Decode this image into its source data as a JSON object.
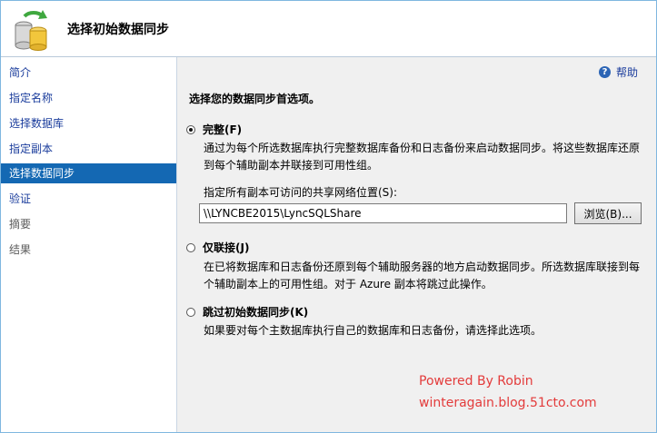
{
  "header": {
    "title": "选择初始数据同步",
    "icon": "database-sync-icon"
  },
  "sidebar": {
    "items": [
      {
        "label": "简介",
        "state": "link"
      },
      {
        "label": "指定名称",
        "state": "link"
      },
      {
        "label": "选择数据库",
        "state": "link"
      },
      {
        "label": "指定副本",
        "state": "link"
      },
      {
        "label": "选择数据同步",
        "state": "active"
      },
      {
        "label": "验证",
        "state": "link"
      },
      {
        "label": "摘要",
        "state": "disabled"
      },
      {
        "label": "结果",
        "state": "disabled"
      }
    ]
  },
  "main": {
    "help_label": "帮助",
    "prompt": "选择您的数据同步首选项。",
    "options": [
      {
        "label": "完整(F)",
        "checked": true,
        "description": "通过为每个所选数据库执行完整数据库备份和日志备份来启动数据同步。将这些数据库还原到每个辅助副本并联接到可用性组。"
      },
      {
        "label": "仅联接(J)",
        "checked": false,
        "description": "在已将数据库和日志备份还原到每个辅助服务器的地方启动数据同步。所选数据库联接到每个辅助副本上的可用性组。对于 Azure 副本将跳过此操作。"
      },
      {
        "label": "跳过初始数据同步(K)",
        "checked": false,
        "description": "如果要对每个主数据库执行自己的数据库和日志备份，请选择此选项。"
      }
    ],
    "share_label": "指定所有副本可访问的共享网络位置(S):",
    "share_path": "\\\\LYNCBE2015\\LyncSQLShare",
    "browse_label": "浏览(B)..."
  },
  "watermark": {
    "line1": "Powered By Robin",
    "line2": "winteragain.blog.51cto.com"
  },
  "colors": {
    "accent": "#1468b3",
    "link": "#1a3c9c",
    "watermark": "#e33b3b",
    "panel": "#f0f0f0"
  }
}
